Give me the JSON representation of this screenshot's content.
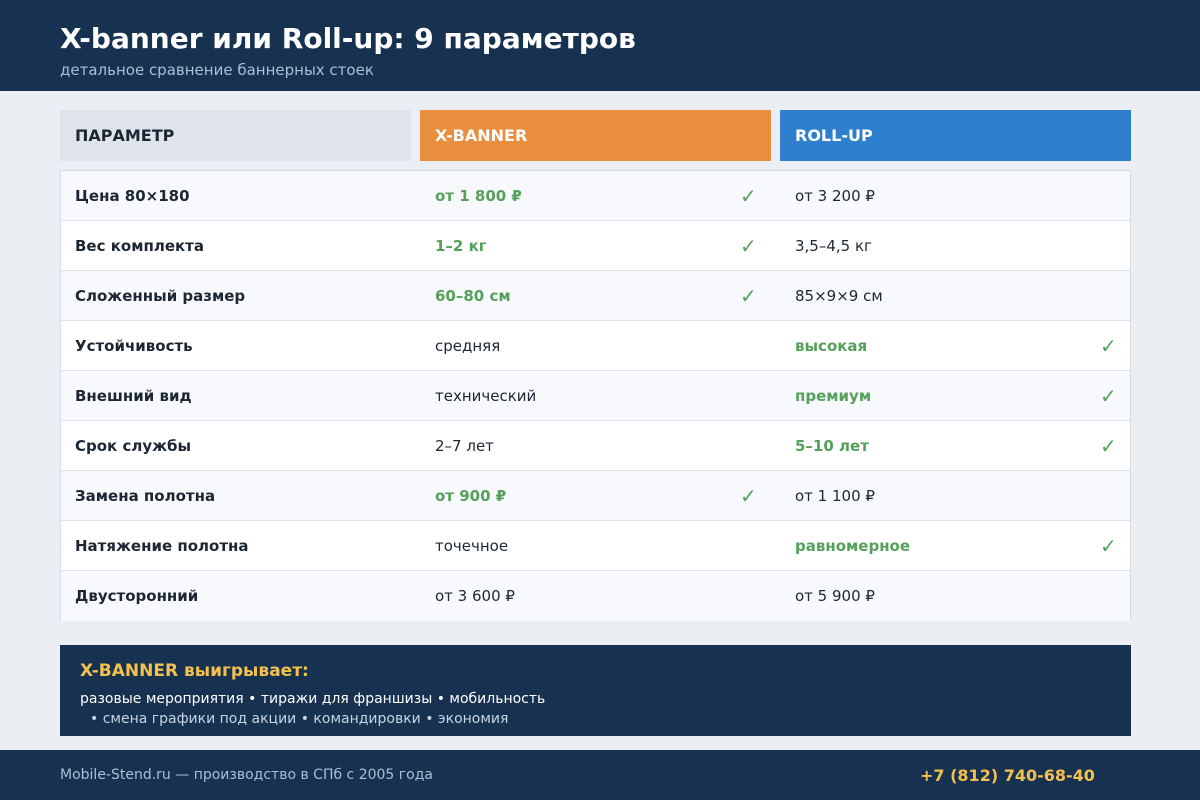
{
  "header": {
    "title": "X-banner или Roll-up: 9 параметров",
    "subtitle": "детальное сравнение баннерных стоек"
  },
  "columns": {
    "param": "ПАРАМЕТР",
    "xbanner": "X-BANNER",
    "rollup": "ROLL-UP"
  },
  "check_symbol": "✓",
  "rows": [
    {
      "param": "Цена 80×180",
      "xbanner": "от 1 800 ₽",
      "rollup": "от 3 200 ₽",
      "winner": "xbanner"
    },
    {
      "param": "Вес комплекта",
      "xbanner": "1–2 кг",
      "rollup": "3,5–4,5 кг",
      "winner": "xbanner"
    },
    {
      "param": "Сложенный размер",
      "xbanner": "60–80 см",
      "rollup": "85×9×9 см",
      "winner": "xbanner"
    },
    {
      "param": "Устойчивость",
      "xbanner": "средняя",
      "rollup": "высокая",
      "winner": "rollup"
    },
    {
      "param": "Внешний вид",
      "xbanner": "технический",
      "rollup": "премиум",
      "winner": "rollup"
    },
    {
      "param": "Срок службы",
      "xbanner": "2–7 лет",
      "rollup": "5–10 лет",
      "winner": "rollup"
    },
    {
      "param": "Замена полотна",
      "xbanner": "от 900 ₽",
      "rollup": "от 1 100 ₽",
      "winner": "xbanner"
    },
    {
      "param": "Натяжение полотна",
      "xbanner": "точечное",
      "rollup": "равномерное",
      "winner": "rollup"
    },
    {
      "param": "Двусторонний",
      "xbanner": "от 3 600 ₽",
      "rollup": "от 5 900 ₽",
      "winner": "none"
    }
  ],
  "summary": {
    "title": "X-BANNER выигрывает:",
    "line1": "разовые мероприятия • тиражи для франшизы • мобильность",
    "line2": "• смена графики под акции • командировки • экономия"
  },
  "footer": {
    "company": "Mobile-Stend.ru — производство в СПб с 2005 года",
    "phone": "+7 (812) 740-68-40"
  },
  "colors": {
    "navy": "#173151",
    "orange": "#e88e3d",
    "blue": "#2e7fcd",
    "green": "#55a05a",
    "gold": "#f2c14e"
  }
}
